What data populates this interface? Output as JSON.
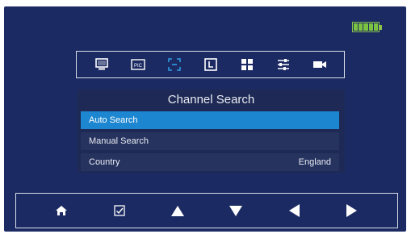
{
  "status": {
    "battery_icon": "battery-full-icon",
    "battery_color": "#7cc242"
  },
  "toolbar": {
    "icons": [
      "monitor-icon",
      "pic-icon",
      "crop-icon",
      "timer-icon",
      "grid-icon",
      "sliders-icon",
      "camera-icon"
    ],
    "pic_label": "PIC"
  },
  "panel": {
    "title": "Channel Search",
    "items": [
      {
        "label": "Auto Search",
        "value": "",
        "selected": true
      },
      {
        "label": "Manual Search",
        "value": ""
      },
      {
        "label": "Country",
        "value": "England"
      }
    ]
  },
  "navbar": {
    "icons": [
      "home-icon",
      "checkbox-icon",
      "up-arrow-icon",
      "down-arrow-icon",
      "left-arrow-icon",
      "right-arrow-icon"
    ]
  },
  "colors": {
    "background": "#1b2a62",
    "accent": "#1d86d0",
    "panel": "#1e2a55"
  }
}
